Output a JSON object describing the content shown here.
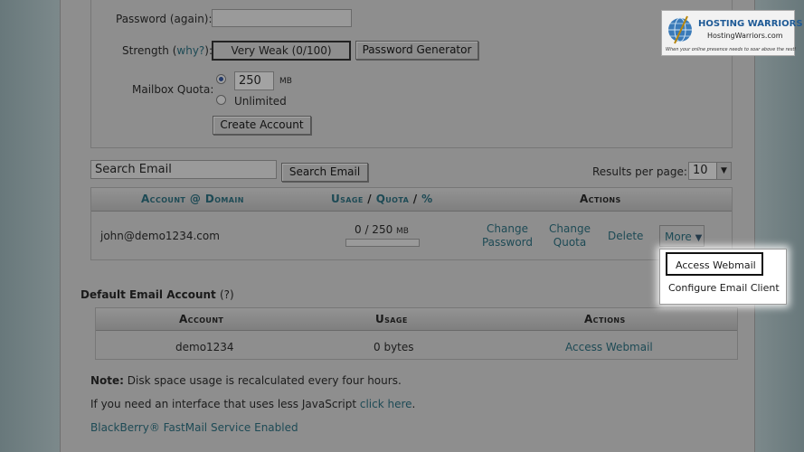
{
  "form": {
    "password_again_label": "Password (again):",
    "strength_label": "Strength (",
    "strength_why": "why?",
    "strength_close": "):",
    "strength_value": "Very Weak (0/100)",
    "password_generator_button": "Password Generator",
    "mailbox_quota_label": "Mailbox Quota:",
    "quota_value": "250",
    "quota_unit": "MB",
    "unlimited_label": "Unlimited",
    "create_account_button": "Create Account"
  },
  "search": {
    "placeholder": "Search Email",
    "button": "Search Email",
    "results_per_page_label": "Results per page:",
    "results_per_page_value": "10"
  },
  "accounts_table": {
    "headers": {
      "account_domain": "Account @ Domain",
      "usage": "Usage",
      "usage_sep1": " / ",
      "quota": "Quota",
      "usage_sep2": " / ",
      "percent": "%",
      "actions": "Actions"
    },
    "row": {
      "email": "john@demo1234.com",
      "usage": "0 / 250",
      "usage_unit": "MB",
      "usage_fraction": 0,
      "change_password_1": "Change",
      "change_password_2": "Password",
      "change_quota_1": "Change",
      "change_quota_2": "Quota",
      "delete": "Delete",
      "more": "More"
    }
  },
  "more_menu": {
    "items": [
      "Access Webmail",
      "Configure Email Client"
    ]
  },
  "default_account": {
    "title": "Default Email Account",
    "help": "(?)",
    "headers": {
      "account": "Account",
      "usage": "Usage",
      "actions": "Actions"
    },
    "row": {
      "account": "demo1234",
      "usage": "0 bytes",
      "action": "Access Webmail"
    }
  },
  "notes": {
    "note_label": "Note:",
    "note_text": " Disk space usage is recalculated every four hours.",
    "js_text": "If you need an interface that uses less JavaScript ",
    "js_link": "click here",
    "js_end": ".",
    "blackberry": "BlackBerry® FastMail Service Enabled"
  },
  "logo": {
    "name": "HOSTING WARRIORS",
    "domain": "HostingWarriors.com",
    "tagline": "When your online presence needs to soar above the rest!"
  }
}
